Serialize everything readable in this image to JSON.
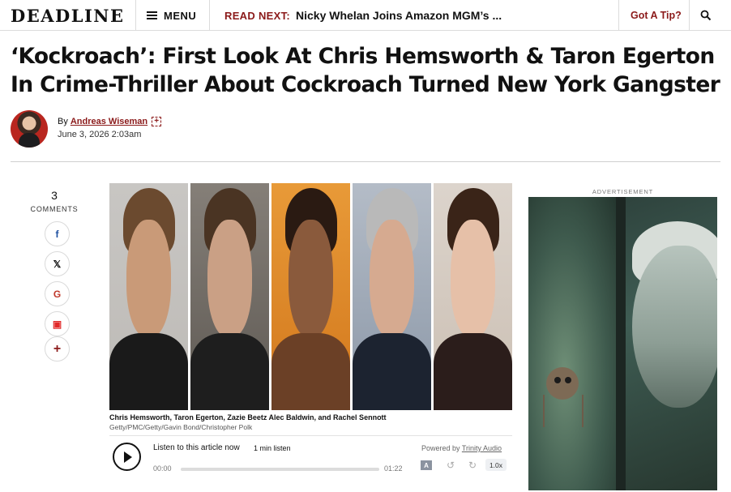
{
  "header": {
    "logo": "DEADLINE",
    "menu_label": "MENU",
    "read_next_label": "READ NEXT:",
    "read_next_title": "Nicky Whelan Joins Amazon MGM’s ...",
    "tip_label": "Got A Tip?",
    "search_icon": "search-icon"
  },
  "article": {
    "headline": "‘Kockroach’: First Look At Chris Hemsworth & Taron Egerton In Crime-Thriller About Cockroach Turned New York Gangster",
    "byline_prefix": "By",
    "author": "Andreas Wiseman",
    "date": "June 3, 2026 2:03am"
  },
  "social": {
    "comment_count": "3",
    "comments_label": "COMMENTS",
    "buttons": [
      {
        "icon": "facebook-icon",
        "glyph": "f"
      },
      {
        "icon": "x-icon",
        "glyph": "𝕏"
      },
      {
        "icon": "google-icon",
        "glyph": "G"
      },
      {
        "icon": "flipboard-icon",
        "glyph": "▣"
      },
      {
        "icon": "more-icon",
        "glyph": "+"
      }
    ]
  },
  "image": {
    "caption": "Chris Hemsworth, Taron Egerton, Zazie Beetz Alec Baldwin, and Rachel Sennott",
    "credit": "Getty/PMC/Getty/Gavin Bond/Christopher Polk"
  },
  "audio": {
    "listen_label": "Listen to this article now",
    "duration_label": "1 min listen",
    "powered_by": "Powered by",
    "provider": "Trinity Audio",
    "current_time": "00:00",
    "total_time": "01:22",
    "progress": 0,
    "speed": "1.0x"
  },
  "ad": {
    "label": "ADVERTISEMENT"
  }
}
